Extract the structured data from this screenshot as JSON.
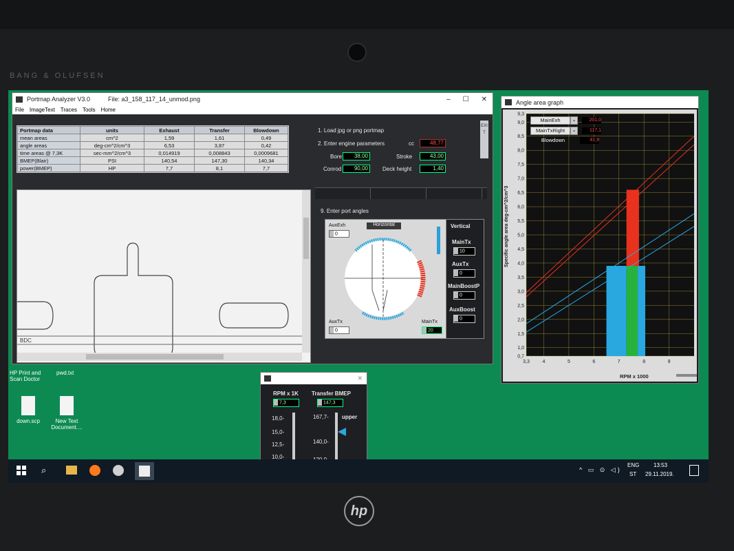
{
  "laptop": {
    "brand": "BANG & OLUFSEN"
  },
  "main_window": {
    "title": "Portmap Analyzer V3.0",
    "file_label": "File: a3_158_117_14_unmod.png",
    "menu": [
      "File",
      "ImageText",
      "Traces",
      "Tools",
      "Home"
    ],
    "table": {
      "headers": [
        "Portmap data",
        "units",
        "Exhaust",
        "Transfer",
        "Blowdown"
      ],
      "rows": [
        [
          "mean areas",
          "cm^2",
          "1,59",
          "1,61",
          "0,49"
        ],
        [
          "angle areas",
          "deg-cm^2/cm^3",
          "6,53",
          "3,87",
          "0,42"
        ],
        [
          "time areas @ 7,3K",
          "sec-mm^2/cm^3",
          "0,014919",
          "0,008843",
          "0,0009681"
        ],
        [
          "BMEP(Blair)",
          "PSI",
          "140,54",
          "147,30",
          "140,34"
        ],
        [
          "power(BMEP)",
          "HP",
          "7,7",
          "8,1",
          "7,7"
        ]
      ]
    },
    "steps": {
      "load": "1. Load jpg or png portmap",
      "enter": "2. Enter engine parameters",
      "port_angles": "9. Enter port angles"
    },
    "params": {
      "cc_label": "cc",
      "cc_value": "48,77",
      "bore_label": "Bore",
      "bore_value": "38,00",
      "stroke_label": "Stroke",
      "stroke_value": "43,00",
      "conrod_label": "Conrod",
      "conrod_value": "90,00",
      "deck_label": "Deck height",
      "deck_value": "1,40"
    },
    "exit_label": "EXIT",
    "bdc_label": "BDC",
    "angles": {
      "auxexh_label": "AuxExh",
      "auxexh_value": "0",
      "horizontal_label": "Horizontal",
      "vertical_label": "Vertical",
      "maintx_label": "MainTx",
      "maintx_value": "10",
      "auxtx_label": "AuxTx",
      "auxtx_value": "0",
      "mainboostp_label": "MainBoostP",
      "mainboostp_value": "0",
      "auxboost_label": "AuxBoost",
      "auxboost_value": "0",
      "bottom_auxtx_label": "AuxTx",
      "bottom_auxtx_value": "0",
      "bottom_maintx_label": "MainTx",
      "bottom_maintx_value": "20"
    }
  },
  "graph_window": {
    "title": "Angle area graph",
    "legend": [
      {
        "name": "MainExh",
        "value": "201,0"
      },
      {
        "name": "MainTxRight",
        "value": "117,1"
      },
      {
        "name": "Blowdown",
        "value": "41,9"
      }
    ],
    "xlabel": "RPM x 1000",
    "ylabel": "Specific angle area  deg-cm^2/cm^3",
    "colors": {
      "exhaust": "#e8321e",
      "transfer": "#29a8e0",
      "blowdown": "#26b33c"
    }
  },
  "chart_data": {
    "type": "line",
    "xlabel": "RPM x 1000",
    "ylabel": "Specific angle area  deg-cm^2/cm^3",
    "xlim": [
      3.3,
      10.0
    ],
    "ylim": [
      0.7,
      9.3
    ],
    "x_ticks": [
      "3,3",
      "4",
      "5",
      "6",
      "7",
      "8",
      "9"
    ],
    "y_ticks": [
      "0,7",
      "1,0",
      "1,5",
      "2,0",
      "2,5",
      "3,0",
      "3,5",
      "4,0",
      "4,5",
      "5,0",
      "5,5",
      "6,0",
      "6,5",
      "7,0",
      "7,5",
      "8,0",
      "8,5",
      "9,0",
      "9,3"
    ],
    "series": [
      {
        "color": "#e8321e",
        "x": [
          3.3,
          10.0
        ],
        "y": [
          2.8,
          8.2
        ]
      },
      {
        "color": "#e8321e",
        "x": [
          3.3,
          10.0
        ],
        "y": [
          2.95,
          8.5
        ]
      },
      {
        "color": "#29a8e0",
        "x": [
          3.3,
          10.0
        ],
        "y": [
          1.55,
          5.3
        ]
      },
      {
        "color": "#29a8e0",
        "x": [
          3.3,
          10.0
        ],
        "y": [
          1.85,
          5.75
        ]
      }
    ],
    "bars": [
      {
        "color": "#29a8e0",
        "x0": 6.5,
        "x1": 7.3,
        "y": 3.9
      },
      {
        "color": "#26b33c",
        "x0": 7.3,
        "x1": 7.75,
        "y": 3.9
      },
      {
        "color": "#29a8e0",
        "x0": 7.75,
        "x1": 8.05,
        "y": 3.9
      },
      {
        "color": "#e8321e",
        "x0": 7.3,
        "x1": 7.8,
        "y0": 3.9,
        "y": 6.6
      }
    ]
  },
  "bmep_window": {
    "rpm_label": "RPM x 1K",
    "rpm_value": "7,3",
    "bmep_label": "Transfer BMEP",
    "bmep_value": "147,3",
    "upper_label": "upper",
    "rpm_ticks": [
      "18,0-",
      "15,0-",
      "12,5-",
      "10,0-"
    ],
    "bmep_ticks": [
      "167,7-",
      "140,0-",
      "120,0"
    ]
  },
  "desktop": {
    "icons": [
      {
        "label": "HP Print and Scan Doctor"
      },
      {
        "label": "pwd.txt"
      },
      {
        "label": "down.scp"
      },
      {
        "label": "New Text Document...."
      }
    ]
  },
  "taskbar": {
    "lang": "ENG",
    "lang2": "ST",
    "time": "13:53",
    "date": "29.11.2019."
  }
}
